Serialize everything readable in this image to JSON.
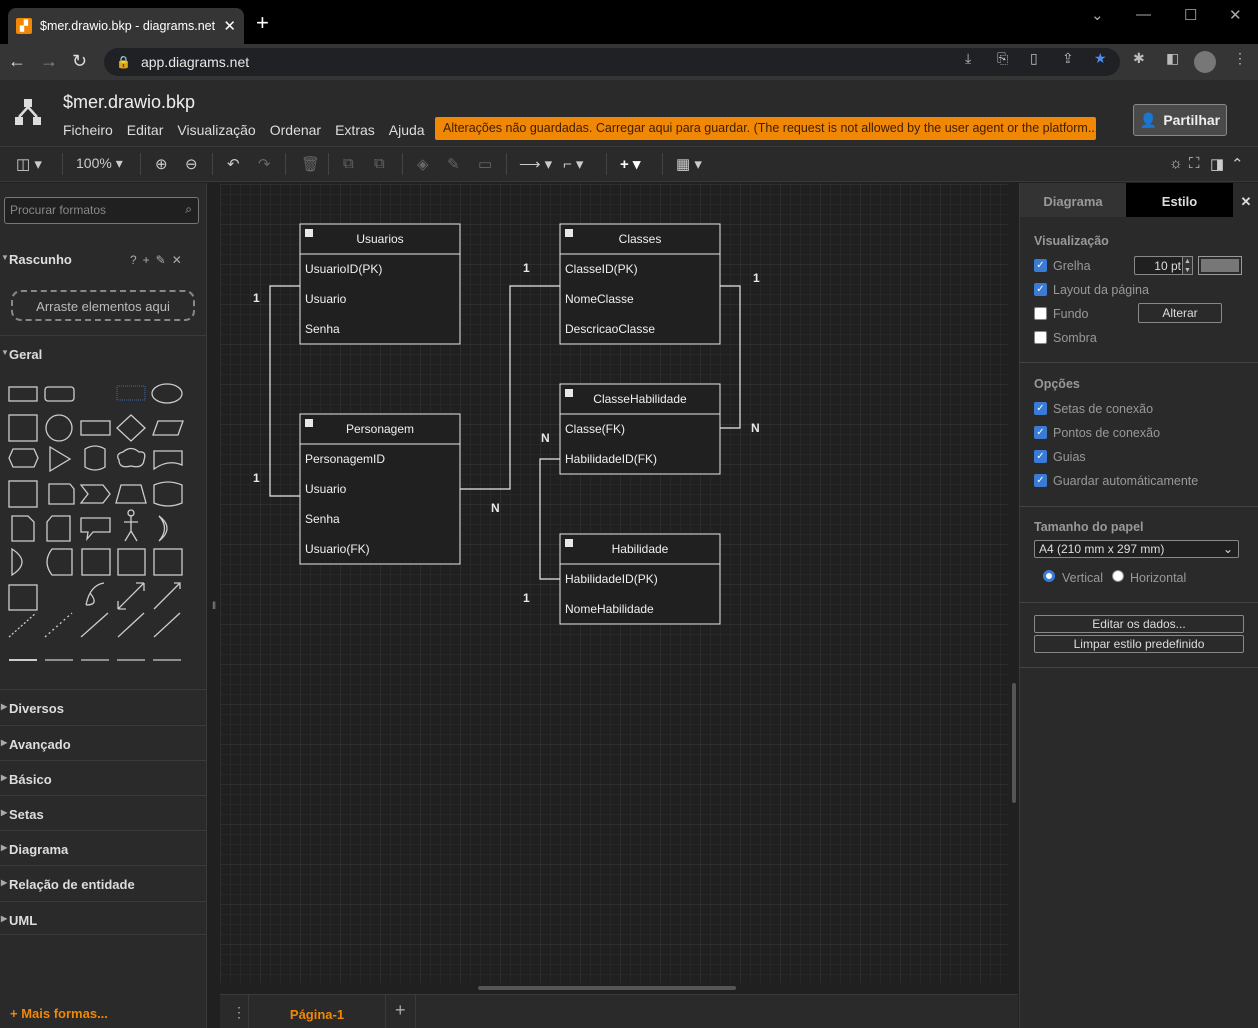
{
  "browser": {
    "tab_title": "$mer.drawio.bkp - diagrams.net",
    "url": "app.diagrams.net"
  },
  "app": {
    "file_title": "$mer.drawio.bkp",
    "menus": [
      "Ficheiro",
      "Editar",
      "Visualização",
      "Ordenar",
      "Extras",
      "Ajuda"
    ],
    "warning": "Alterações não guardadas. Carregar aqui para guardar. (The request is not allowed by the user agent or the platform...)",
    "share_label": "Partilhar",
    "accent": "#f08705"
  },
  "toolbar": {
    "zoom": "100%"
  },
  "left_panel": {
    "search_placeholder": "Procurar formatos",
    "scratch_title": "Rascunho",
    "scratch_drop": "Arraste elementos aqui",
    "general_title": "Geral",
    "sections": [
      "Diversos",
      "Avançado",
      "Básico",
      "Setas",
      "Diagrama",
      "Relação de entidade",
      "UML"
    ],
    "more_shapes": "+ Mais formas..."
  },
  "diagram": {
    "tables": [
      {
        "name": "Usuarios",
        "fields": [
          "UsuarioID(PK)",
          "Usuario",
          "Senha"
        ]
      },
      {
        "name": "Classes",
        "fields": [
          "ClasseID(PK)",
          "NomeClasse",
          "DescricaoClasse"
        ]
      },
      {
        "name": "Personagem",
        "fields": [
          "PersonagemID",
          "Usuario",
          "Senha",
          "Usuario(FK)"
        ]
      },
      {
        "name": "ClasseHabilidade",
        "fields": [
          "Classe(FK)",
          "HabilidadeID(FK)"
        ]
      },
      {
        "name": "Habilidade",
        "fields": [
          "HabilidadeID(PK)",
          "NomeHabilidade"
        ]
      }
    ],
    "cardinalities": [
      "1",
      "1",
      "1",
      "1",
      "N",
      "N",
      "N",
      "1"
    ]
  },
  "page_tabs": {
    "current": "Página-1"
  },
  "right_panel": {
    "tab_diagram": "Diagrama",
    "tab_style": "Estilo",
    "view_title": "Visualização",
    "grid_label": "Grelha",
    "grid_size": "10 pt",
    "page_layout_label": "Layout da página",
    "background_label": "Fundo",
    "change_label": "Alterar",
    "shadow_label": "Sombra",
    "options_title": "Opções",
    "connection_arrows": "Setas de conexão",
    "connection_points": "Pontos de conexão",
    "guides": "Guias",
    "autosave": "Guardar automáticamente",
    "paper_title": "Tamanho do papel",
    "paper_size": "A4 (210 mm x 297 mm)",
    "vertical": "Vertical",
    "horizontal": "Horizontal",
    "edit_data": "Editar os dados...",
    "clear_style": "Limpar estilo predefinido"
  }
}
